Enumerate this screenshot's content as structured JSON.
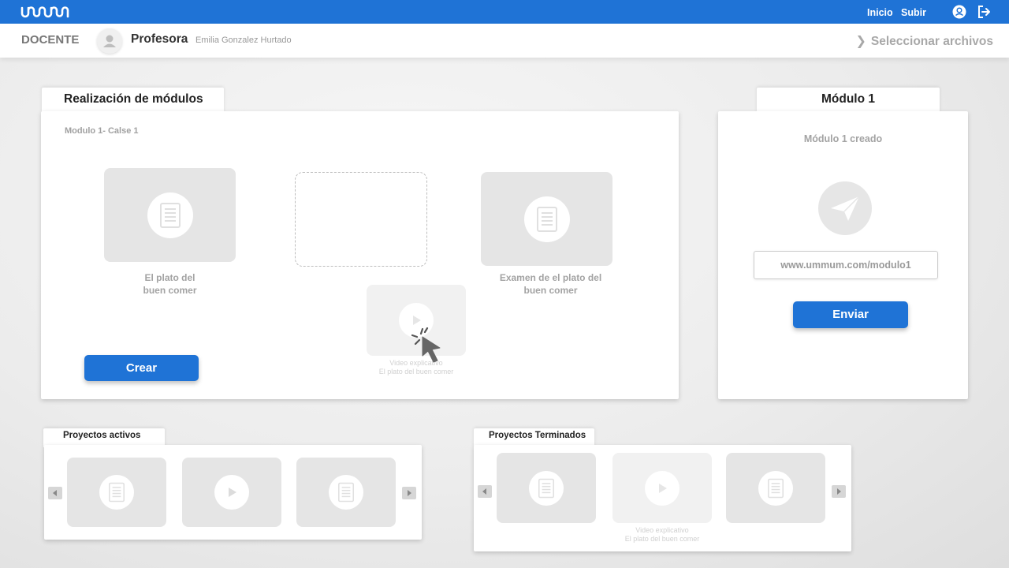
{
  "topbar": {
    "logo_text": "ummum",
    "nav": [
      "Inicio",
      "Subir"
    ],
    "color": "#1f73d6"
  },
  "header": {
    "role": "DOCENTE",
    "user_title": "Profesora",
    "user_name": "Emilia Gonzalez Hurtado",
    "select_files": "Seleccionar archivos"
  },
  "modules_panel": {
    "tab_title": "Realización de módulos",
    "subtitle": "Modulo 1- Calse 1",
    "card1_label": [
      "El plato del",
      "buen comer"
    ],
    "card3_label": [
      "Examen de el plato del",
      "buen comer"
    ],
    "video_label": [
      "Video explicativo",
      "El plato del buen comer"
    ],
    "create_button": "Crear"
  },
  "module_panel": {
    "tab_title": "Módulo 1",
    "status": "Módulo 1 creado",
    "url": "www.ummum.com/modulo1",
    "send_button": "Enviar"
  },
  "active_projects": {
    "tab_title": "Proyectos activos",
    "items": [
      "document-icon",
      "play-icon",
      "document-icon"
    ]
  },
  "finished_projects": {
    "tab_title": "Proyectos Terminados",
    "items": [
      "document-icon",
      "play-icon",
      "document-icon"
    ],
    "video_label": [
      "Video explicativo",
      "El plato del buen comer"
    ]
  }
}
